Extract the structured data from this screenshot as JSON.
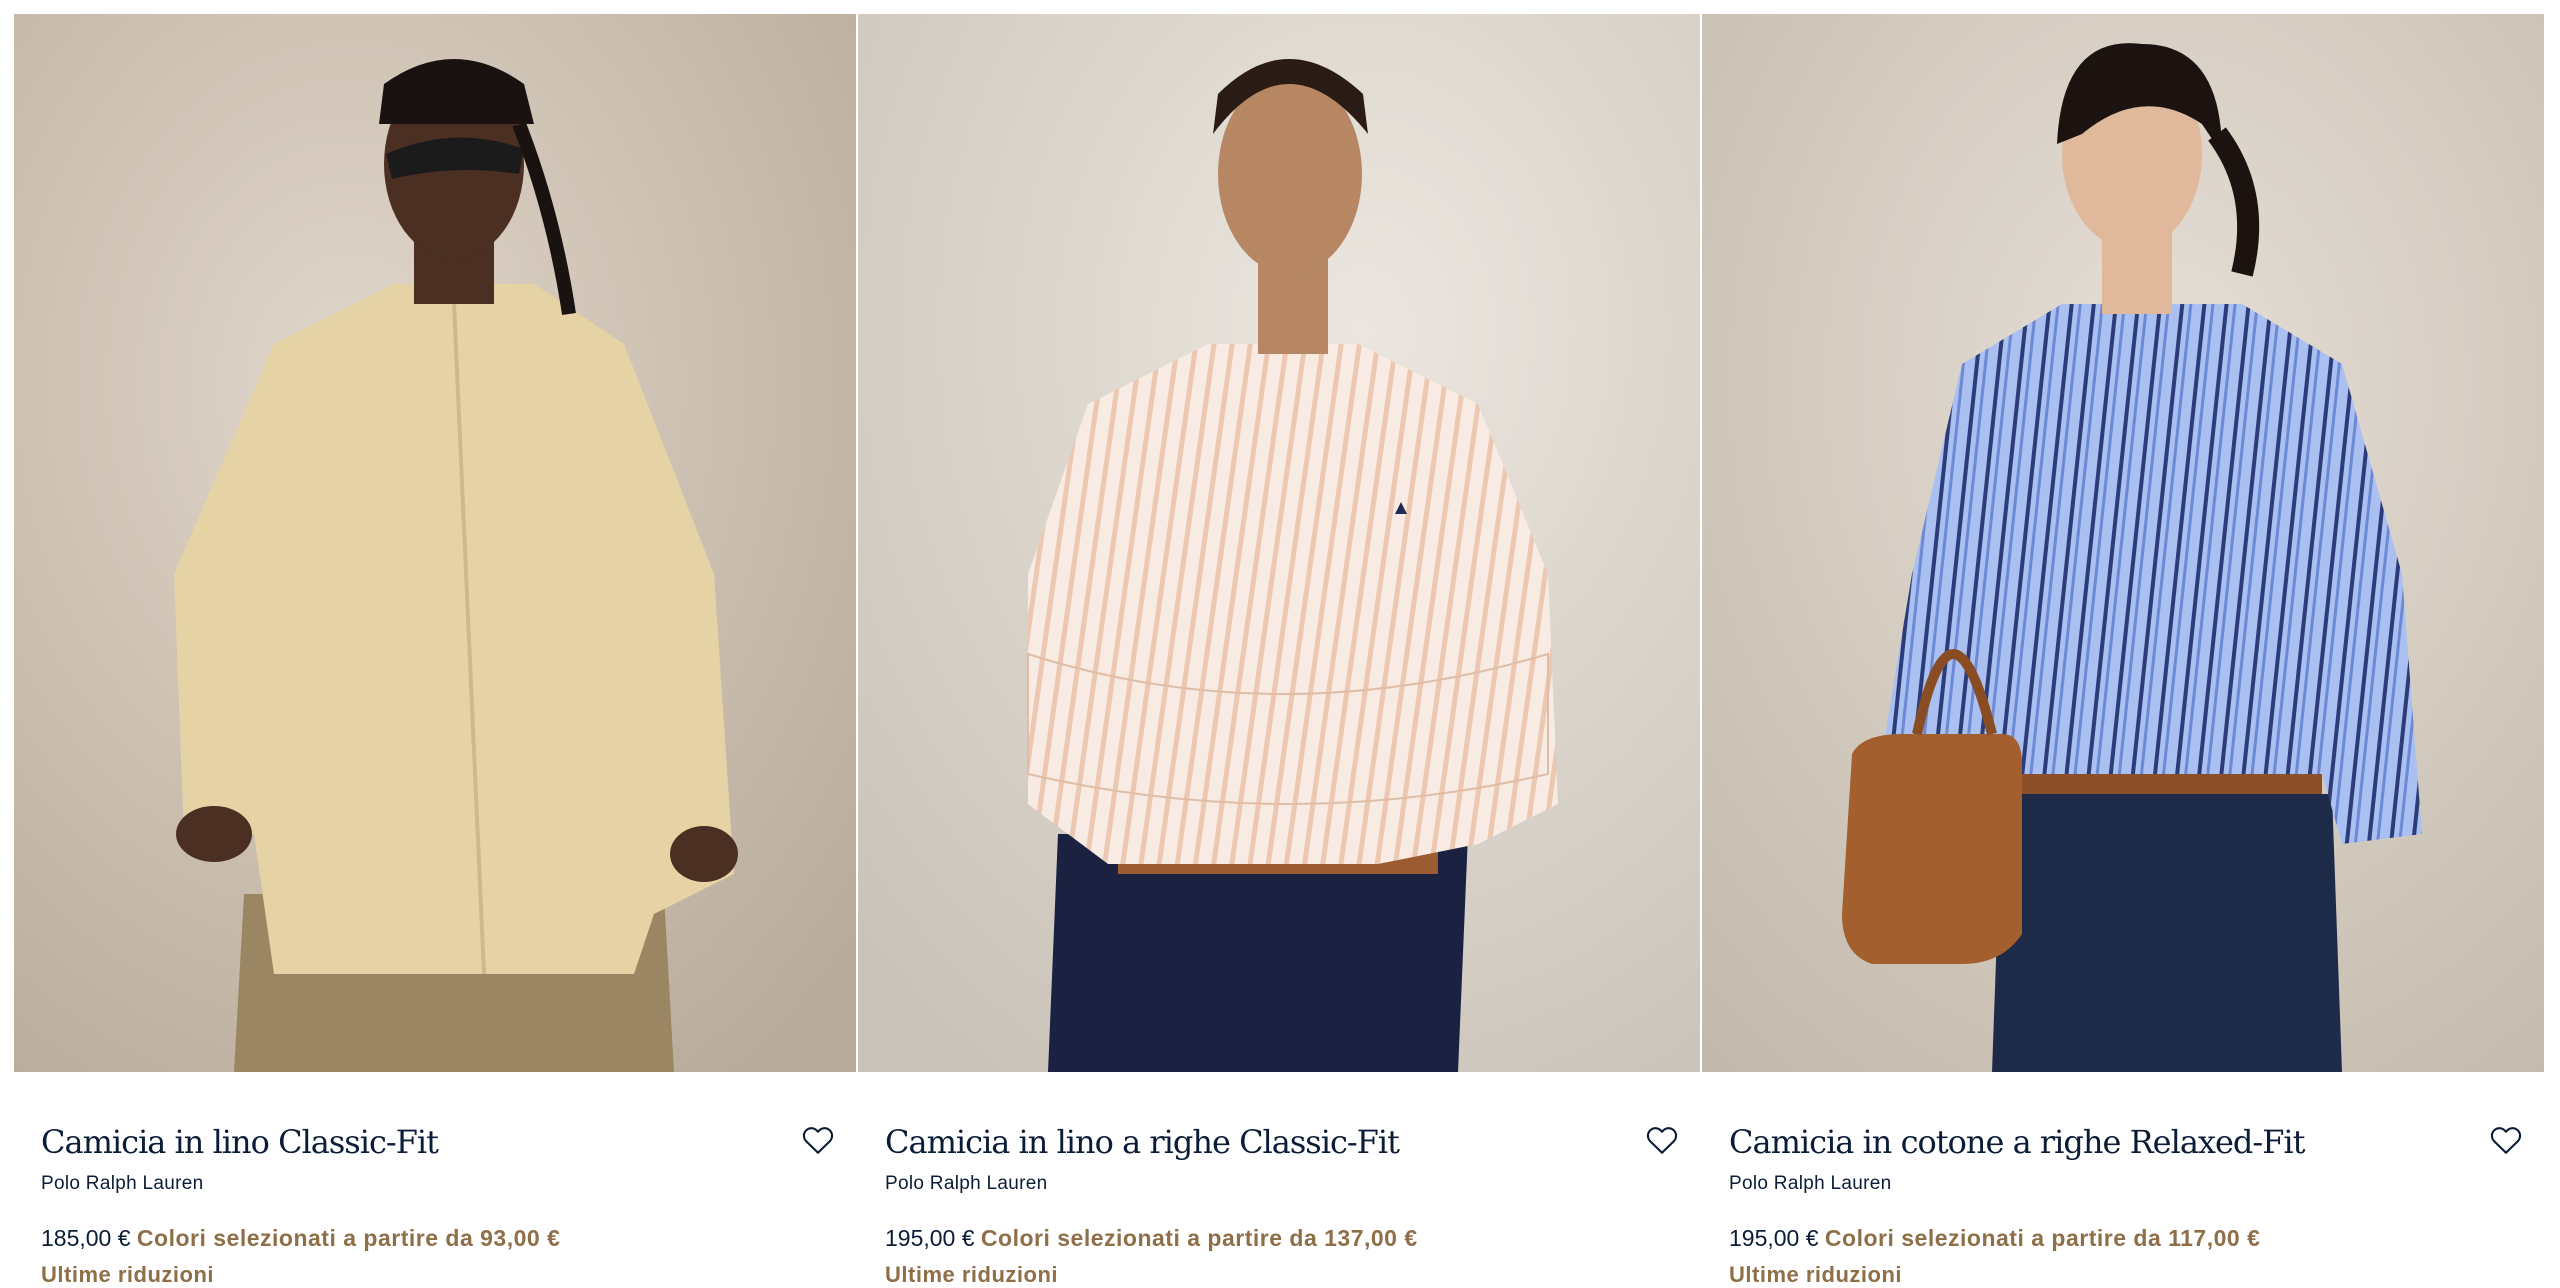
{
  "products": [
    {
      "title": "Camicia in lino Classic-Fit",
      "brand": "Polo Ralph Lauren",
      "price": "185,00 €",
      "promo": "Colori selezionati a partire da 93,00 €",
      "badge": "Ultime riduzioni",
      "image_alt": "Camicia in lino Classic-Fit",
      "shirt_color": "#e6d3a5"
    },
    {
      "title": "Camicia in lino a righe Classic-Fit",
      "brand": "Polo Ralph Lauren",
      "price": "195,00 €",
      "promo": "Colori selezionati a partire da 137,00 €",
      "badge": "Ultime riduzioni",
      "image_alt": "Camicia in lino a righe Classic-Fit",
      "shirt_color": "#f6e3da"
    },
    {
      "title": "Camicia in cotone a righe Relaxed-Fit",
      "brand": "Polo Ralph Lauren",
      "price": "195,00 €",
      "promo": "Colori selezionati a partire da 117,00 €",
      "badge": "Ultime riduzioni",
      "image_alt": "Camicia in cotone a righe Relaxed-Fit",
      "shirt_color": "#9fb8ee"
    }
  ],
  "icons": {
    "wishlist": "heart-outline-icon"
  },
  "colors": {
    "text_primary": "#0b1c36",
    "accent_promo": "#8e6f48"
  }
}
